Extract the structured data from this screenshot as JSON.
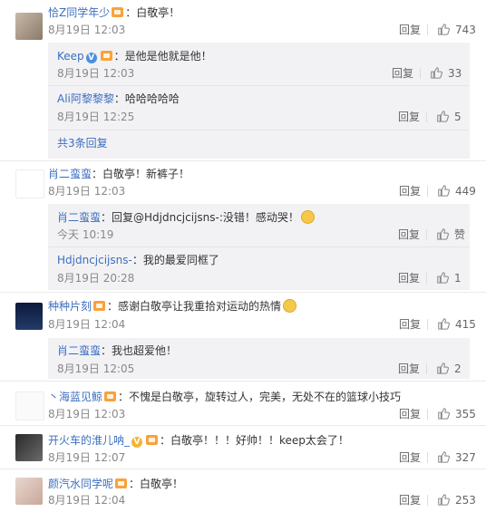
{
  "comments": [
    {
      "name": "恰Z同学年少",
      "text": "：白敬亭！",
      "time": "8月19日 12:03",
      "reply": "回复",
      "likes": "743",
      "replies": [
        {
          "name": "Keep",
          "text": "：是他是他就是他！",
          "time": "8月19日 12:03",
          "reply": "回复",
          "likes": "33"
        },
        {
          "name": "Ali阿黎黎黎",
          "text": "：哈哈哈哈哈",
          "time": "8月19日 12:25",
          "reply": "回复",
          "likes": "5"
        }
      ],
      "more": "共3条回复"
    },
    {
      "name": "肖二蛮蛮",
      "text": "：白敬亭！新裤子！",
      "time": "8月19日 12:03",
      "reply": "回复",
      "likes": "449",
      "replies": [
        {
          "name": "肖二蛮蛮",
          "text": "：回复@Hdjdncjcijsns-:没错！感动哭！",
          "time": "今天 10:19",
          "reply": "回复",
          "likes": "赞"
        },
        {
          "name": "Hdjdncjcijsns-",
          "text": "：我的最爱同框了",
          "time": "8月19日 20:28",
          "reply": "回复",
          "likes": "1"
        }
      ]
    },
    {
      "name": "种种片刻",
      "text": "：感谢白敬亭让我重拾对运动的热情",
      "time": "8月19日 12:04",
      "reply": "回复",
      "likes": "415",
      "replies": [
        {
          "name": "肖二蛮蛮",
          "text": "：我也超爱他！",
          "time": "8月19日 12:05",
          "reply": "回复",
          "likes": "2"
        }
      ]
    },
    {
      "name": "丶海蓝见鲸",
      "text": "：不愧是白敬亭，旋转过人，完美，无处不在的篮球小技巧",
      "time": "8月19日 12:03",
      "reply": "回复",
      "likes": "355"
    },
    {
      "name": "开火车的淮儿呐_",
      "text": "：白敬亭！！！好帅！！keep太会了！",
      "time": "8月19日 12:07",
      "reply": "回复",
      "likes": "327"
    },
    {
      "name": "颜汽水同学呢",
      "text": "：白敬亭！",
      "time": "8月19日 12:04",
      "reply": "回复",
      "likes": "253"
    }
  ],
  "icons": {
    "thumb": "thumbs-up-icon",
    "member_badge": "member-crown-icon",
    "verified": "verified-v-icon",
    "emoji": "emoji-icon"
  },
  "colors": {
    "name_link": "#3c6ebf",
    "badge": "#f9a23a",
    "verified_blue": "#4a90e2",
    "verified_gold": "#f3b43a",
    "reply_bg": "#f2f2f5"
  }
}
